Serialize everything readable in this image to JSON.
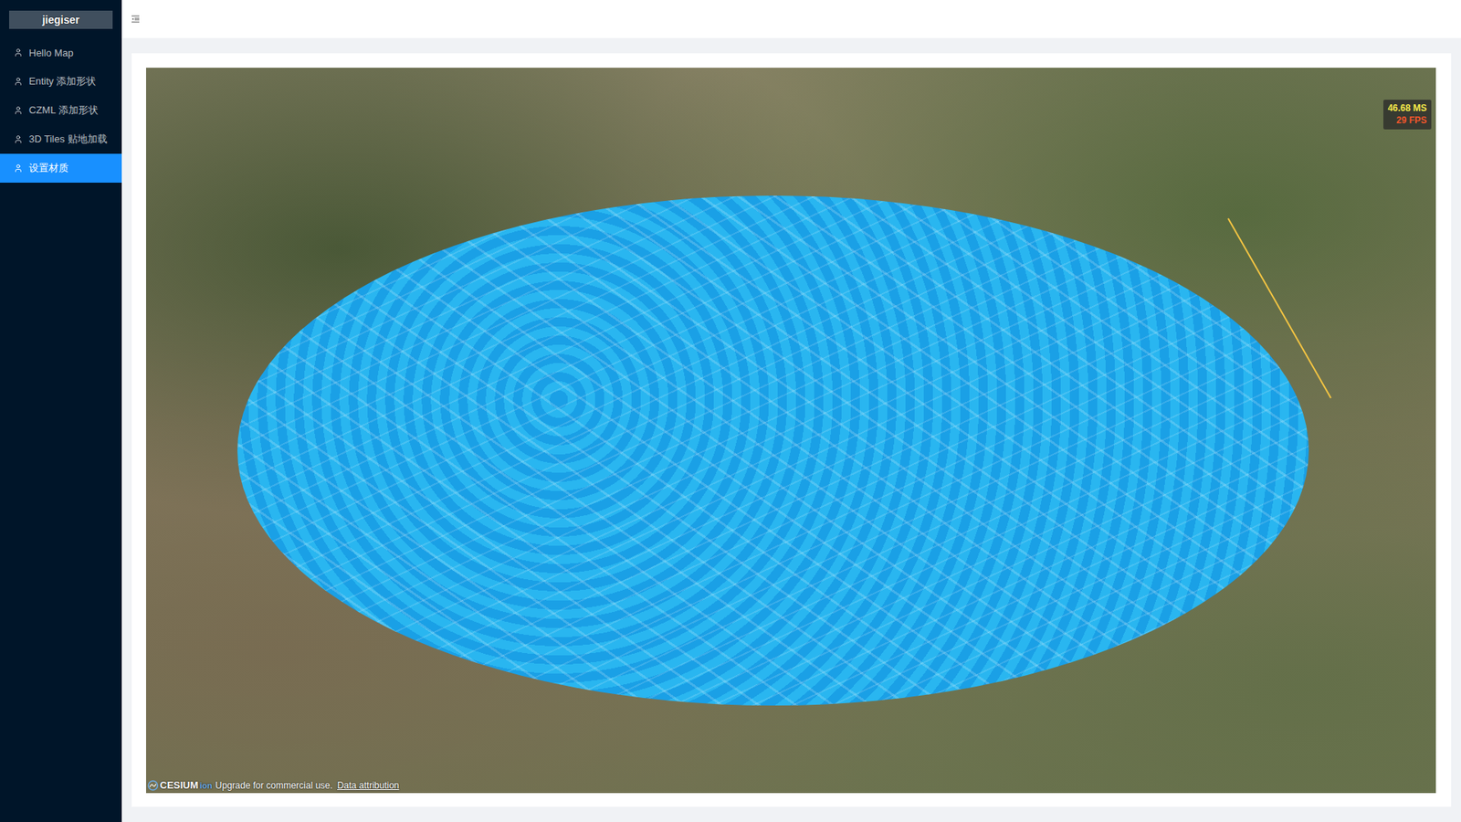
{
  "sidebar": {
    "logo": "jiegiser",
    "items": [
      {
        "label": "Hello Map",
        "selected": false
      },
      {
        "label": "Entity 添加形状",
        "selected": false
      },
      {
        "label": "CZML 添加形状",
        "selected": false
      },
      {
        "label": "3D Tiles 贴地加载",
        "selected": false
      },
      {
        "label": "设置材质",
        "selected": true
      }
    ]
  },
  "map": {
    "performance": {
      "ms": "46.68 MS",
      "fps": "29 FPS"
    },
    "credits": {
      "logo": "CESIUM",
      "logo_suffix": "ion",
      "text": "Upgrade for commercial use.",
      "link": "Data attribution"
    }
  }
}
